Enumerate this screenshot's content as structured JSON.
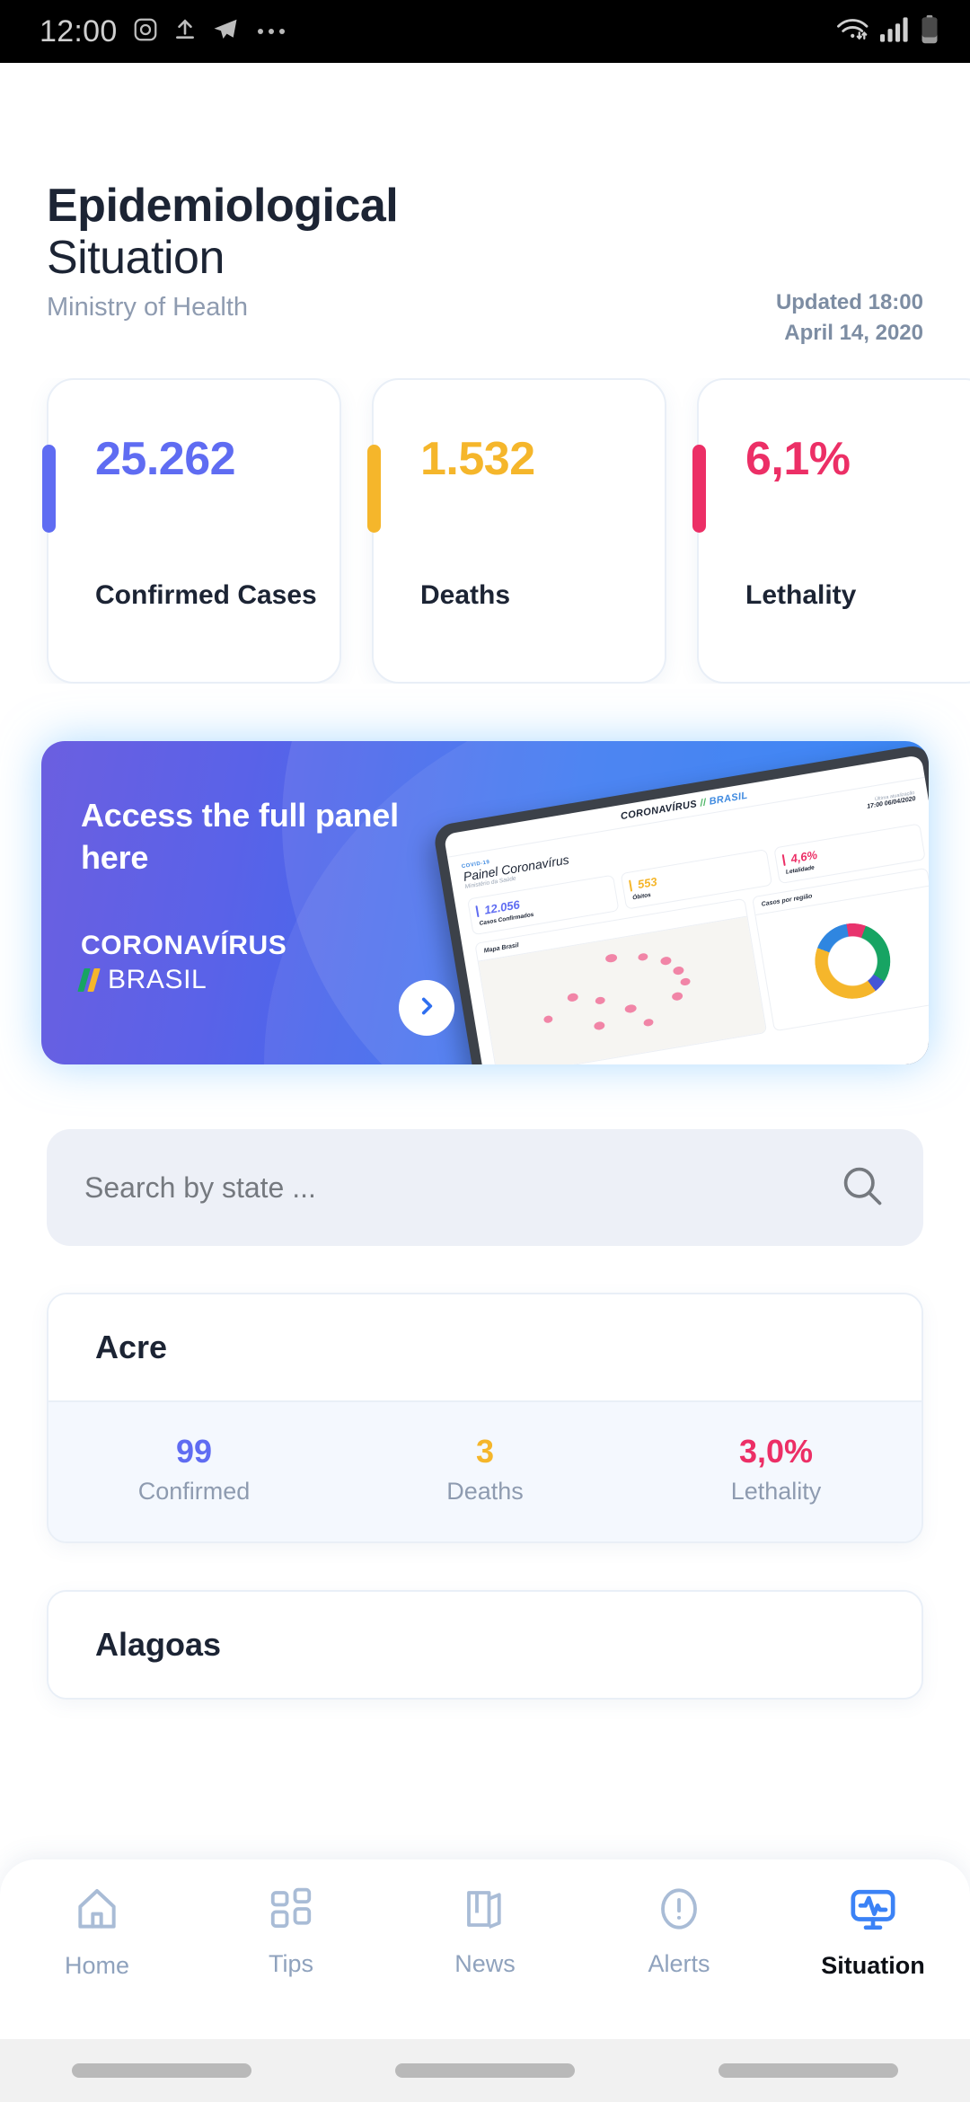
{
  "status_bar": {
    "time": "12:00",
    "left_icons": [
      "instagram-icon",
      "upload-icon",
      "telegram-icon",
      "overflow-dots-icon"
    ],
    "right_icons": [
      "wifi-icon",
      "signal-icon",
      "battery-icon"
    ]
  },
  "header": {
    "title_line1": "Epidemiological",
    "title_line2": "Situation",
    "subtitle": "Ministry of Health",
    "updated_time": "Updated 18:00",
    "updated_date": "April 14, 2020"
  },
  "summary_cards": [
    {
      "value": "25.262",
      "label": "Confirmed Cases",
      "color": "#5f6cf2"
    },
    {
      "value": "1.532",
      "label": "Deaths",
      "color": "#f5b62b"
    },
    {
      "value": "6,1%",
      "label": "Lethality",
      "color": "#ec2f66"
    }
  ],
  "banner": {
    "headline": "Access the full panel here",
    "brand_top": "CORONAVÍRUS",
    "brand_bottom": "BRASIL",
    "arrow_icon": "chevron-right-icon",
    "tablet": {
      "brand_prefix": "CORONAVÍRUS",
      "brand_slash": "//",
      "brand_suffix": "BRASIL",
      "covid_tag": "COVID-19",
      "title_bold": "Painel",
      "title_light": " Coronavírus",
      "ministry": "Ministério da Saúde",
      "updated_label": "Última atualização",
      "updated_value": "17:00 06/04/2020",
      "cards": [
        {
          "value": "12.056",
          "label": "Casos Confirmados",
          "color": "#5f6cf2"
        },
        {
          "value": "553",
          "label": "Óbitos",
          "color": "#f5b62b"
        },
        {
          "value": "4,6%",
          "label": "Letalidade",
          "color": "#ec2f66"
        }
      ],
      "map_panel_title": "Mapa Brasil",
      "region_panel_title": "Casos por região"
    }
  },
  "search": {
    "placeholder": "Search by state ...",
    "value": "",
    "icon": "search-icon"
  },
  "states": [
    {
      "name": "Acre",
      "stats": [
        {
          "value": "99",
          "label": "Confirmed",
          "color": "#5f6cf2"
        },
        {
          "value": "3",
          "label": "Deaths",
          "color": "#f5b62b"
        },
        {
          "value": "3,0%",
          "label": "Lethality",
          "color": "#ec2f66"
        }
      ]
    },
    {
      "name": "Alagoas",
      "stats": []
    }
  ],
  "bottom_nav": {
    "items": [
      {
        "label": "Home",
        "icon": "home-icon",
        "active": false
      },
      {
        "label": "Tips",
        "icon": "grid-icon",
        "active": false
      },
      {
        "label": "News",
        "icon": "newspaper-icon",
        "active": false
      },
      {
        "label": "Alerts",
        "icon": "alert-icon",
        "active": false
      },
      {
        "label": "Situation",
        "icon": "monitor-pulse-icon",
        "active": true
      }
    ]
  },
  "theme": {
    "blue": "#5f6cf2",
    "yellow": "#f5b62b",
    "pink": "#ec2f66",
    "nav_active": "#3b82f6",
    "nav_inactive": "#a9bcd6",
    "text_dark": "#1c2434",
    "text_muted": "#8e9bb0"
  }
}
